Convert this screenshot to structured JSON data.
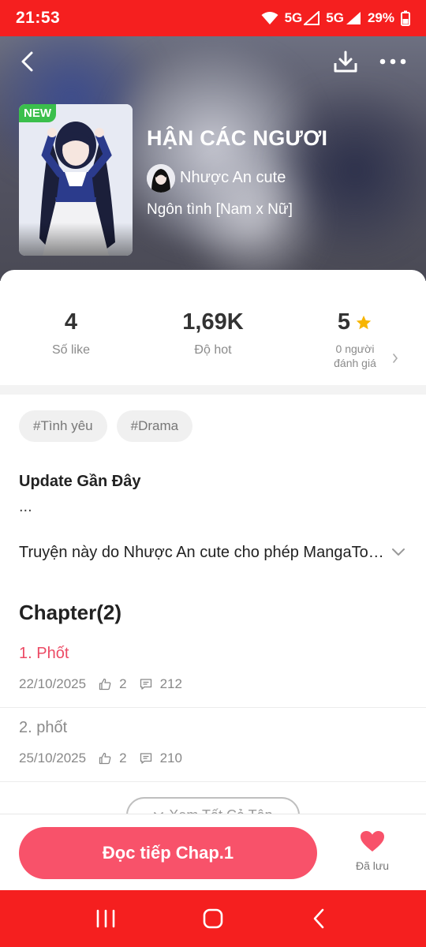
{
  "status_bar": {
    "time": "21:53",
    "net1": "5G",
    "net2": "5G",
    "battery": "29%"
  },
  "header": {
    "back_icon": "back-arrow-icon",
    "download_icon": "download-icon",
    "more_icon": "more-icon"
  },
  "comic": {
    "badge": "NEW",
    "title": "HẬN CÁC NGƯƠI",
    "author": "Nhược An cute",
    "genre": "Ngôn tình [Nam x Nữ]"
  },
  "stats": {
    "likes_value": "4",
    "likes_label": "Số like",
    "hot_value": "1,69K",
    "hot_label": "Độ hot",
    "rating_value": "5",
    "rating_label_line1": "0 người",
    "rating_label_line2": "đánh giá"
  },
  "tags": [
    "#Tình yêu",
    "#Drama"
  ],
  "update": {
    "title": "Update Gần Đây",
    "text": "..."
  },
  "description": "Truyện này do Nhược An cute cho phép MangaToon đăng tải",
  "chapters": {
    "header": "Chapter(2)",
    "items": [
      {
        "name": "1. Phốt",
        "date": "22/10/2025",
        "likes": "2",
        "comments": "212"
      },
      {
        "name": "2. phốt",
        "date": "25/10/2025",
        "likes": "2",
        "comments": "210"
      }
    ],
    "view_all": "Xem Tất Cả Tập"
  },
  "bottom_bar": {
    "read_button": "Đọc tiếp Chap.1",
    "saved_label": "Đã lưu"
  },
  "colors": {
    "status_red": "#f51f1f",
    "accent_pink": "#f8526a",
    "active_chapter": "#ec4a64",
    "new_badge": "#3bbf4c",
    "star": "#f7b500"
  }
}
